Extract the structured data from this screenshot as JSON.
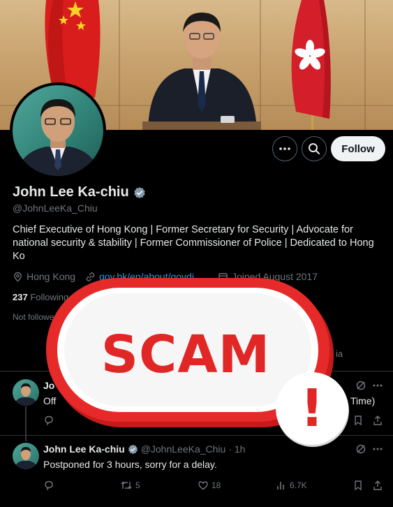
{
  "profile": {
    "name": "John Lee Ka-chiu",
    "handle": "@JohnLeeKa_Chiu",
    "bio": "Chief Executive of Hong Kong | Former Secretary for Security | Advocate for national security & stability | Former Commissioner of Police | Dedicated to Hong Ko",
    "location": "Hong Kong",
    "website": "gov.hk/en/about/govdi",
    "joined": "Joined August 2017",
    "following_count": "237",
    "following_label": "Following",
    "not_followed_text": "Not followe",
    "media_fragment": "ia"
  },
  "actions": {
    "follow_label": "Follow",
    "more_icon": "more-horizontal-icon",
    "search_icon": "search-icon"
  },
  "tweets": [
    {
      "name": "Jo",
      "text_start": "Off",
      "text_end": "Time)"
    },
    {
      "name": "John Lee Ka-chiu",
      "handle": "@JohnLeeKa_Chiu",
      "time": "· 1h",
      "text": "Postponed for 3 hours, sorry for a delay.",
      "retweets": "5",
      "likes": "18",
      "views": "6.7K"
    }
  ],
  "overlay": {
    "label": "SCAM",
    "alert_mark": "!"
  },
  "colors": {
    "accent_blue": "#1d9bf0",
    "scam_red": "#e12626",
    "verified_gray": "#829aab",
    "background": "#000000"
  }
}
